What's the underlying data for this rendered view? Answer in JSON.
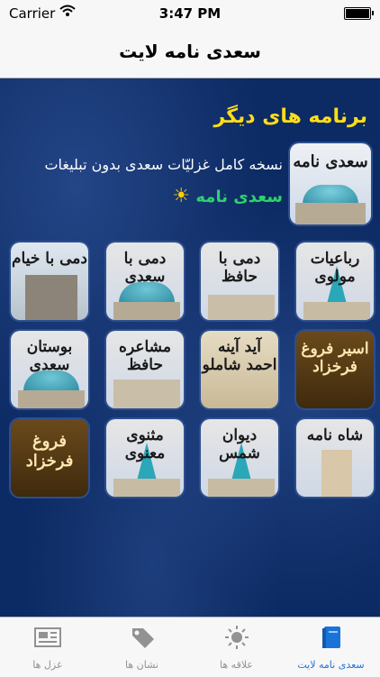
{
  "status_bar": {
    "carrier": "Carrier",
    "time": "3:47 PM"
  },
  "nav": {
    "title": "سعدی نامه لایت"
  },
  "more_apps": {
    "heading": "برنامه های دیگر",
    "featured": {
      "icon_label": "سعدی نامه",
      "description": "نسخه کامل غزلیّات سعدی بدون تبلیغات",
      "link": "سعدی نامه"
    }
  },
  "apps": [
    {
      "label": "رباعیات مولوی"
    },
    {
      "label": "دمی با حافظ"
    },
    {
      "label": "دمی با سعدی"
    },
    {
      "label": "دمی با خیام"
    },
    {
      "label": "اسیر فروغ فرخزاد"
    },
    {
      "label": "آید آینه احمد شاملو"
    },
    {
      "label": "مشاعره حافظ"
    },
    {
      "label": "بوستان سعدی"
    },
    {
      "label": "شاه نامه"
    },
    {
      "label": "دیوان شمس"
    },
    {
      "label": "مثنوی معنوی"
    },
    {
      "label": "فروغ فرخزاد"
    }
  ],
  "tabs": [
    {
      "label": "غزل ها",
      "icon": "newspaper-icon"
    },
    {
      "label": "نشان ها",
      "icon": "tag-icon"
    },
    {
      "label": "علاقه ها",
      "icon": "sun-icon"
    },
    {
      "label": "سعدی نامه لایت",
      "icon": "book-icon"
    }
  ],
  "colors": {
    "accent": "#1a73d9",
    "heading": "#ffdd1a",
    "link": "#2dd36a",
    "background": "#0c2a63"
  }
}
